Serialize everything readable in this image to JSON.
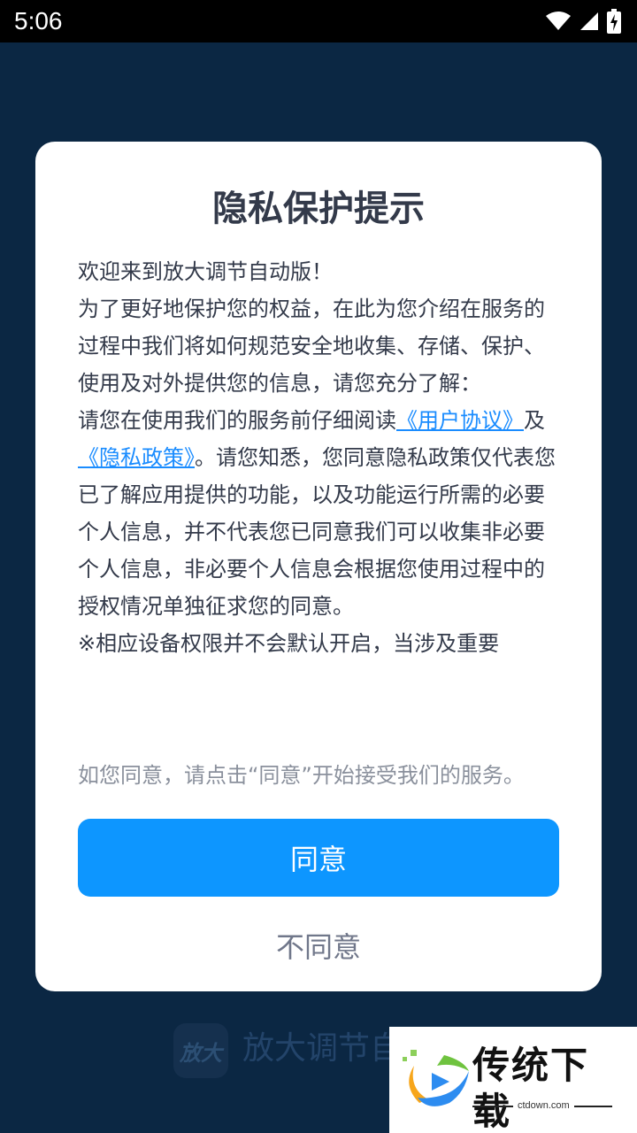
{
  "status_bar": {
    "time": "5:06",
    "icons": [
      "wifi-icon",
      "cell-signal-icon",
      "battery-charging-icon"
    ]
  },
  "dialog": {
    "title": "隐私保护提示",
    "body": {
      "p1": "欢迎来到放大调节自动版！",
      "p2": "为了更好地保护您的权益，在此为您介绍在服务的过程中我们将如何规范安全地收集、存储、保护、使用及对外提供您的信息，请您充分了解：",
      "p3_before": "请您在使用我们的服务前仔细阅读",
      "user_agreement_link": "《用户协议》",
      "p3_and": "及",
      "privacy_policy_link": "《隐私政策》",
      "p3_after": "。请您知悉，您同意隐私政策仅代表您已了解应用提供的功能，以及功能运行所需的必要个人信息，并不代表您已同意我们可以收集非必要个人信息，非必要个人信息会根据您使用过程中的授权情况单独征求您的同意。",
      "p4": "※相应设备权限并不会默认开启，当涉及重要"
    },
    "consent_hint": "如您同意，请点击“同意”开始接受我们的服务。",
    "agree_label": "同意",
    "disagree_label": "不同意"
  },
  "background": {
    "app_logo_text": "放大",
    "app_name": "放大调节自"
  },
  "watermark": {
    "title": "传统下载",
    "url": "ctdown.com"
  },
  "colors": {
    "background": "#0b2743",
    "accent": "#0d96ff",
    "link": "#1a8cff",
    "body_text": "#333a4a",
    "hint_text": "#8a909c"
  }
}
